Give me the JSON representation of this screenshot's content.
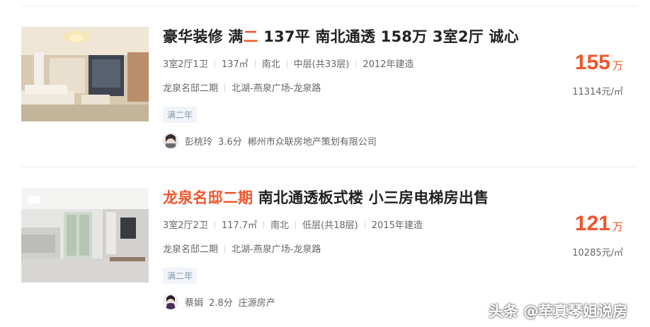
{
  "listings": [
    {
      "title_parts": [
        "豪华装修 满",
        "二",
        " 137平 南北通透 158万 3室2厅 诚心"
      ],
      "layout": "3室2厅1卫",
      "area": "137㎡",
      "orientation": "南北",
      "floor": "中层(共33层)",
      "year": "2012年建造",
      "community": "龙泉名邸二期",
      "district": "北湖-燕泉广场-龙泉路",
      "tag": "满二年",
      "agent_name": "彭桃玲",
      "agent_score": "3.6分",
      "agent_company": "郴州市众联房地产策划有限公司",
      "price": "155",
      "price_unit": "万",
      "unit_price": "11314元/㎡"
    },
    {
      "title_parts": [
        "龙泉名邸二期",
        " 南北通透板式楼 小三房电梯房出售"
      ],
      "layout": "3室2厅2卫",
      "area": "117.7㎡",
      "orientation": "南北",
      "floor": "低层(共18层)",
      "year": "2015年建造",
      "community": "龙泉名邸二期",
      "district": "北湖-燕泉广场-龙泉路",
      "tag": "满二年",
      "agent_name": "蔡娟",
      "agent_score": "2.8分",
      "agent_company": "庄源房产",
      "price": "121",
      "price_unit": "万",
      "unit_price": "10285元/㎡"
    }
  ],
  "watermark": "头条 @荦真琴姐说房",
  "colors": {
    "accent": "#f0552b",
    "tag_text": "#849aae",
    "tag_bg": "#f1f4f8"
  }
}
